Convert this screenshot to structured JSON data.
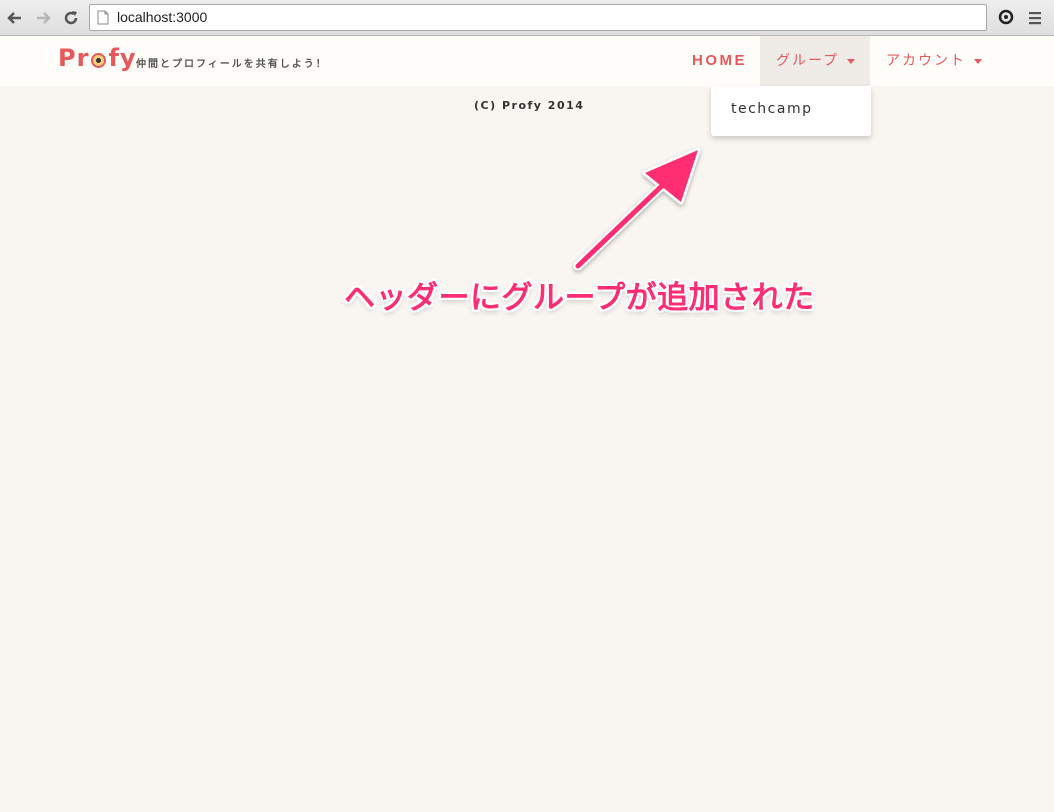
{
  "browser": {
    "url": "localhost:3000"
  },
  "header": {
    "logo": {
      "part1": "Pr",
      "part2": "fy"
    },
    "tagline": "仲間とプロフィールを共有しよう！",
    "nav": {
      "home": "HOME",
      "group": "グループ",
      "account": "アカウント"
    }
  },
  "dropdown": {
    "items": [
      "techcamp"
    ]
  },
  "footer": {
    "copyright": "(C) Profy 2014"
  },
  "annotation": {
    "text": "ヘッダーにグループが追加された",
    "color": "#ff2e73"
  },
  "colors": {
    "brand": "#e8595b",
    "background": "#f9f6f1"
  }
}
